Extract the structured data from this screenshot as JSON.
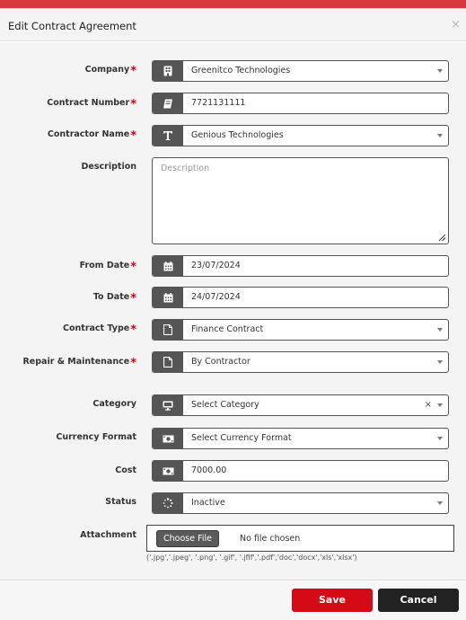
{
  "modal": {
    "title": "Edit Contract Agreement",
    "close_glyph": "×"
  },
  "required_mark": "*",
  "fields": {
    "company": {
      "label": "Company",
      "value": "Greenitco Technologies",
      "icon": "building-icon"
    },
    "contract_number": {
      "label": "Contract Number",
      "value": "7721131111",
      "icon": "book-icon"
    },
    "contractor_name": {
      "label": "Contractor Name",
      "value": "Genious Technologies",
      "icon": "text-icon"
    },
    "description": {
      "label": "Description",
      "placeholder": "Description"
    },
    "from_date": {
      "label": "From Date",
      "value": "23/07/2024",
      "icon": "calendar-icon"
    },
    "to_date": {
      "label": "To Date",
      "value": "24/07/2024",
      "icon": "calendar-icon"
    },
    "contract_type": {
      "label": "Contract Type",
      "value": "Finance Contract",
      "icon": "file-icon"
    },
    "repair_maintenance": {
      "label": "Repair & Maintenance",
      "value": "By Contractor",
      "icon": "file-icon"
    },
    "category": {
      "label": "Category",
      "value": "Select Category",
      "clear": "×",
      "icon": "monitor-icon"
    },
    "currency_format": {
      "label": "Currency Format",
      "value": "Select Currency Format",
      "icon": "money-icon"
    },
    "cost": {
      "label": "Cost",
      "value": "7000.00",
      "icon": "money-icon"
    },
    "status": {
      "label": "Status",
      "value": "Inactive",
      "icon": "spinner-icon"
    },
    "attachment": {
      "label": "Attachment",
      "button_label": "Choose File",
      "status": "No file chosen",
      "hint": "('.jpg','.jpeg', '.png', '.gif', '.jfif','.pdf','doc','docx','xls','xlsx')"
    }
  },
  "buttons": {
    "save": "Save",
    "cancel": "Cancel"
  },
  "colors": {
    "accent": "#d9383c",
    "save": "#d50a17",
    "cancel": "#222222",
    "addon": "#555555",
    "required": "#d0021b"
  }
}
